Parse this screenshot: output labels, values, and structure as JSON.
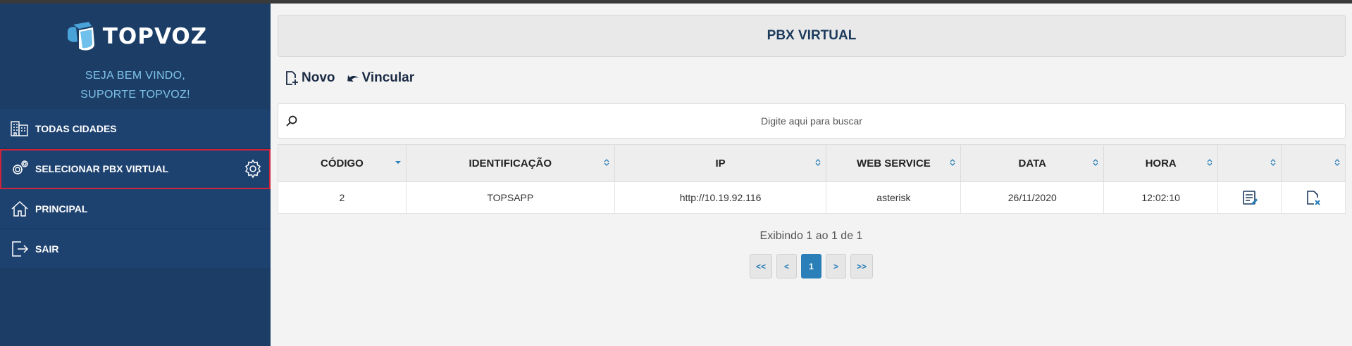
{
  "brand": {
    "name": "TOPVOZ",
    "welcome_line1": "SEJA BEM VINDO,",
    "welcome_line2": "SUPORTE TOPVOZ!"
  },
  "sidebar": {
    "items": [
      {
        "label": "TODAS CIDADES",
        "icon": "buildings-icon"
      },
      {
        "label": "SELECIONAR PBX VIRTUAL",
        "icon": "gear-icon",
        "active": true
      },
      {
        "label": "PRINCIPAL",
        "icon": "home-icon"
      },
      {
        "label": "SAIR",
        "icon": "logout-icon"
      }
    ]
  },
  "page": {
    "title": "PBX VIRTUAL"
  },
  "actions": {
    "new_label": "Novo",
    "link_label": "Vincular"
  },
  "search": {
    "placeholder": "Digite aqui para buscar"
  },
  "table": {
    "headers": [
      "CÓDIGO",
      "IDENTIFICAÇÃO",
      "IP",
      "WEB SERVICE",
      "DATA",
      "HORA",
      "",
      ""
    ],
    "rows": [
      [
        "2",
        "TOPSAPP",
        "http://10.19.92.116",
        "asterisk",
        "26/11/2020",
        "12:02:10"
      ]
    ]
  },
  "summary": "Exibindo 1 ao 1 de 1",
  "pagination": {
    "first": "<<",
    "prev": "<",
    "current": "1",
    "next": ">",
    "last": ">>"
  },
  "colors": {
    "sidebar": "#1b3d66",
    "accent": "#2a7fb8",
    "welcome": "#7fc3ea",
    "active_border": "#d0243a"
  }
}
